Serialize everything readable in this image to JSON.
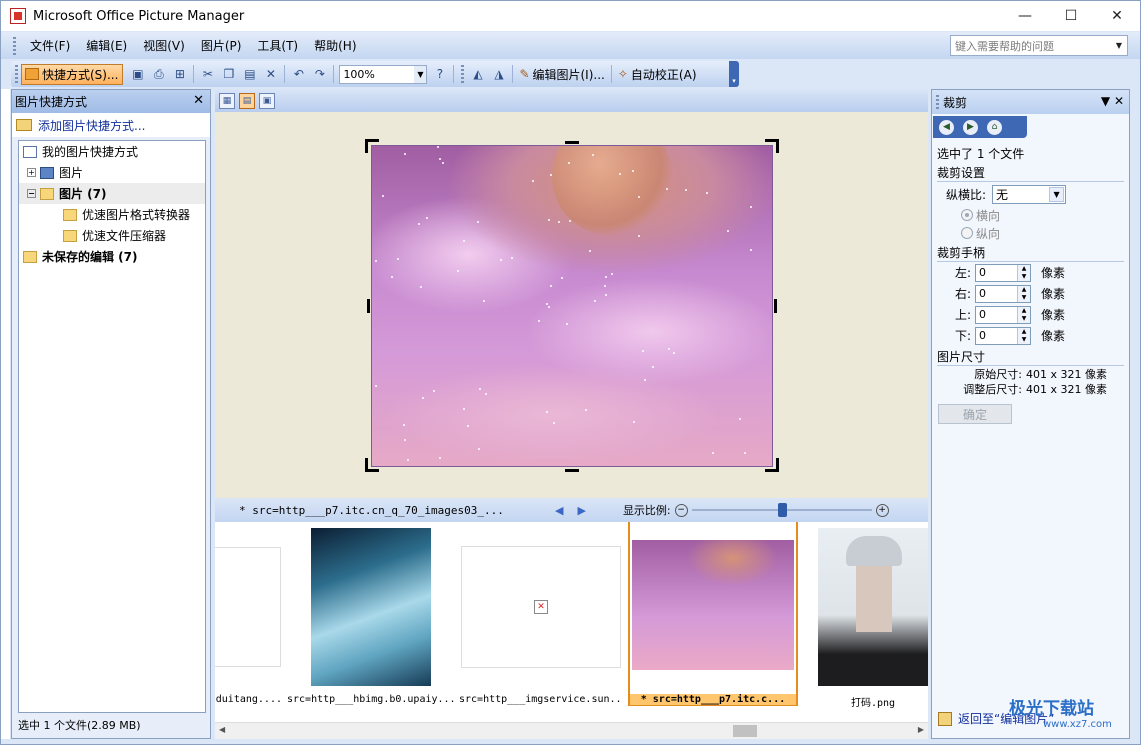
{
  "window": {
    "title": "Microsoft Office Picture Manager"
  },
  "menu": {
    "items": [
      "文件(F)",
      "编辑(E)",
      "视图(V)",
      "图片(P)",
      "工具(T)",
      "帮助(H)"
    ],
    "help_placeholder": "键入需要帮助的问题"
  },
  "toolbar": {
    "shortcut_label": "快捷方式(S)...",
    "zoom_value": "100%",
    "edit_picture_label": "编辑图片(I)...",
    "auto_correct_label": "自动校正(A)"
  },
  "left_pane": {
    "title": "图片快捷方式",
    "add_shortcut": "添加图片快捷方式...",
    "tree": {
      "root": "我的图片快捷方式",
      "pictures": "图片",
      "pictures_bold": "图片 (7)",
      "folder1": "优速图片格式转换器",
      "folder2": "优速文件压缩器",
      "unsaved": "未保存的编辑 (7)"
    },
    "status": "选中 1 个文件(2.89 MB)"
  },
  "nav": {
    "filename": "* src=http___p7.itc.cn_q_70_images03_...",
    "zoom_label": "显示比例:",
    "zoom_fraction": 0.5
  },
  "filmstrip": {
    "captions": [
      "duitang....",
      "src=http___hbimg.b0.upaiy...",
      "src=http___imgservice.sun...",
      "* src=http___p7.itc.c...",
      "打码.png"
    ]
  },
  "right_pane": {
    "title": "裁剪",
    "selected": "选中了 1 个文件",
    "crop_settings": "裁剪设置",
    "aspect_label": "纵横比:",
    "aspect_value": "无",
    "landscape": "横向",
    "portrait": "纵向",
    "handles_title": "裁剪手柄",
    "left_label": "左:",
    "right_label": "右:",
    "top_label": "上:",
    "bottom_label": "下:",
    "left_val": "0",
    "right_val": "0",
    "top_val": "0",
    "bottom_val": "0",
    "unit": "像素",
    "size_title": "图片尺寸",
    "original_label": "原始尺寸:",
    "original_val": "401 x 321 像素",
    "adjusted_label": "调整后尺寸:",
    "adjusted_val": "401 x 321 像素",
    "ok": "确定",
    "back": "返回至“编辑图片”"
  },
  "watermark": {
    "line1": "极光下载站",
    "line2": "www.xz7.com"
  },
  "colors": {
    "accent": "#3e67b4",
    "selection": "#ffc66d",
    "pane_header": "#bcd0f0"
  }
}
